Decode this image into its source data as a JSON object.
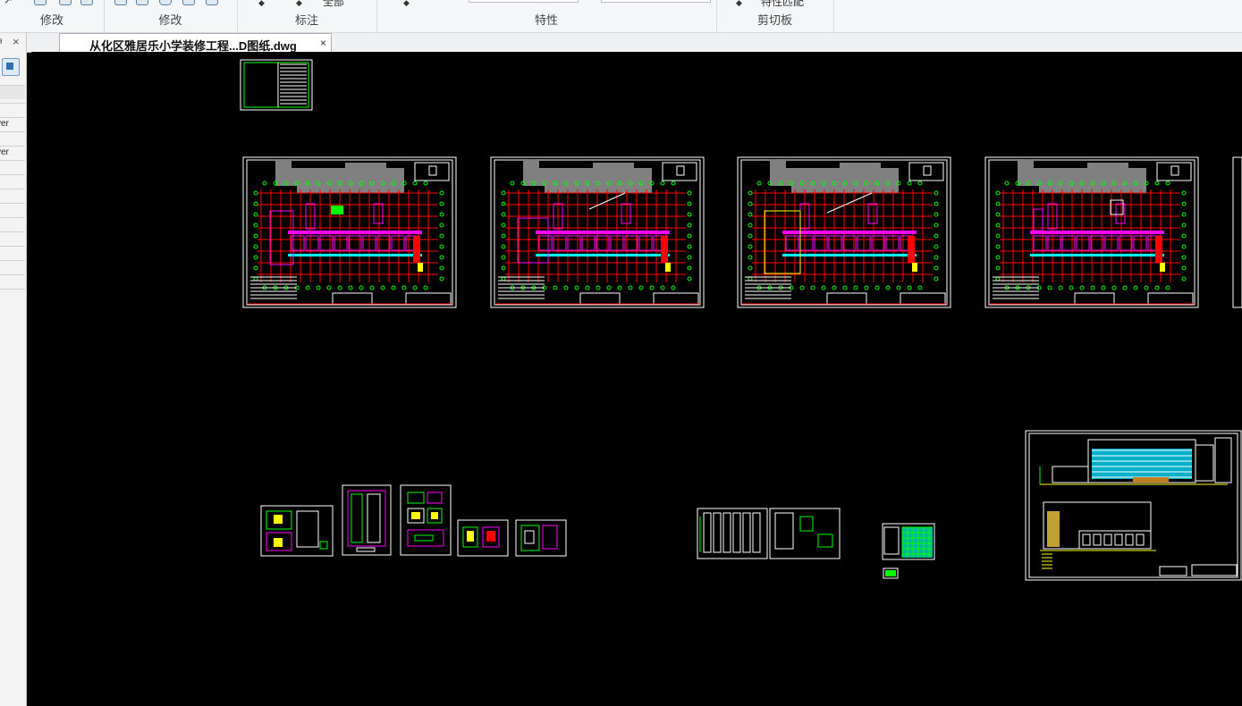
{
  "ribbon": {
    "groups": [
      {
        "label": "修改"
      },
      {
        "label": "标注"
      },
      {
        "label": "特性"
      },
      {
        "label": "剪切板"
      }
    ],
    "partial_labels": {
      "dim_all": "全部",
      "clipboard_tool": "特性匹配"
    }
  },
  "palette": {
    "header": {
      "pin": "ᵼ",
      "close": "×"
    },
    "rows": [
      "",
      "",
      "yer",
      "",
      "yer",
      "",
      "",
      "",
      "",
      "",
      "",
      "",
      "",
      ""
    ]
  },
  "document_tab": {
    "title": "从化区雅居乐小学装修工程...D图纸.dwg",
    "close": "×"
  },
  "canvas": {
    "background": "#000000",
    "drawing_colors": {
      "frame": "#ffffff",
      "grid": "#ff0000",
      "walls": "#ff00ff",
      "dims": "#00ff00",
      "roof": "#808080",
      "glass": "#00ffff",
      "accent": "#ffff00"
    }
  }
}
